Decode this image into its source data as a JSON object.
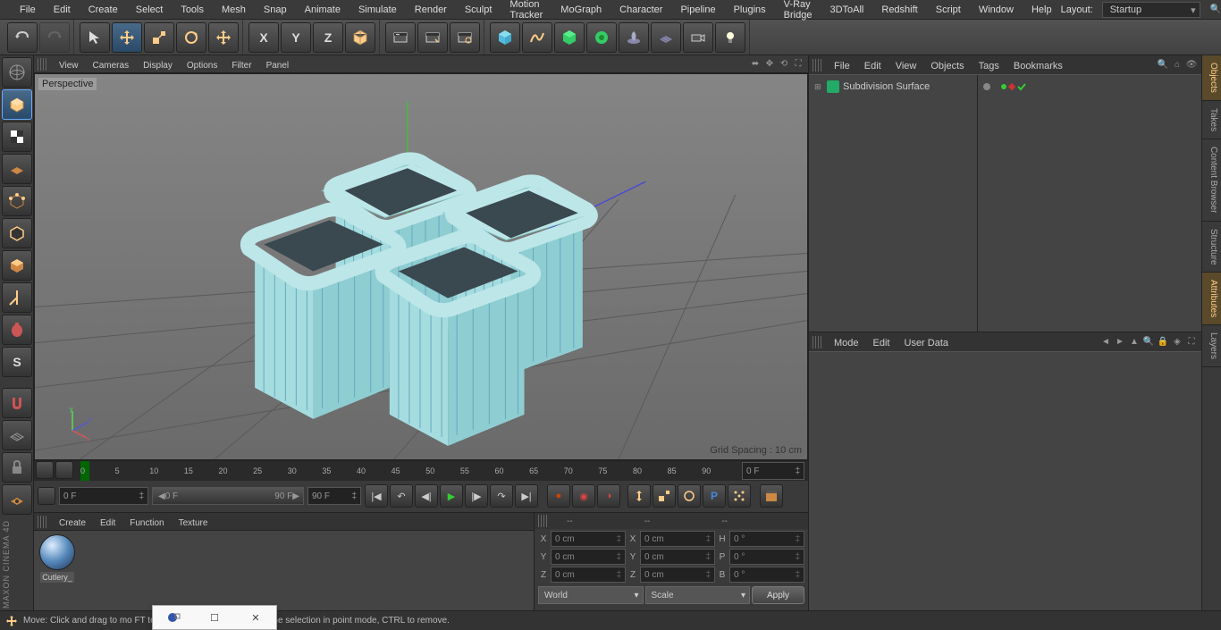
{
  "menubar": [
    "File",
    "Edit",
    "Create",
    "Select",
    "Tools",
    "Mesh",
    "Snap",
    "Animate",
    "Simulate",
    "Render",
    "Sculpt",
    "Motion Tracker",
    "MoGraph",
    "Character",
    "Pipeline",
    "Plugins",
    "V-Ray Bridge",
    "3DToAll",
    "Redshift",
    "Script",
    "Window",
    "Help"
  ],
  "layout": {
    "label": "Layout:",
    "value": "Startup"
  },
  "viewport": {
    "menus": [
      "View",
      "Cameras",
      "Display",
      "Options",
      "Filter",
      "Panel"
    ],
    "label": "Perspective",
    "grid_spacing": "Grid Spacing : 10 cm"
  },
  "timeline": {
    "marks": [
      "0",
      "5",
      "10",
      "15",
      "20",
      "25",
      "30",
      "35",
      "40",
      "45",
      "50",
      "55",
      "60",
      "65",
      "70",
      "75",
      "80",
      "85",
      "90"
    ],
    "end_field": "0 F",
    "f1": "0 F",
    "f2": "0 F",
    "f3": "90 F",
    "f4": "90 F"
  },
  "materials": {
    "menus": [
      "Create",
      "Edit",
      "Function",
      "Texture"
    ],
    "thumb_label": "Cutlery_"
  },
  "coords": {
    "header": [
      "--",
      "--",
      "--"
    ],
    "rows": [
      {
        "a": "X",
        "v1": "0 cm",
        "b": "X",
        "v2": "0 cm",
        "c": "H",
        "v3": "0 °"
      },
      {
        "a": "Y",
        "v1": "0 cm",
        "b": "Y",
        "v2": "0 cm",
        "c": "P",
        "v3": "0 °"
      },
      {
        "a": "Z",
        "v1": "0 cm",
        "b": "Z",
        "v2": "0 cm",
        "c": "B",
        "v3": "0 °"
      }
    ],
    "dd1": "World",
    "dd2": "Scale",
    "apply": "Apply"
  },
  "objects": {
    "menus": [
      "File",
      "Edit",
      "View",
      "Objects",
      "Tags",
      "Bookmarks"
    ],
    "item": "Subdivision Surface"
  },
  "attributes": {
    "menus": [
      "Mode",
      "Edit",
      "User Data"
    ]
  },
  "right_tabs": [
    "Objects",
    "Takes",
    "Content Browser",
    "Structure",
    "Attributes",
    "Layers"
  ],
  "status": "Move: Click and drag to mo                              FT to quantize movement / add to the selection in point mode, CTRL to remove.",
  "axes": [
    "X",
    "Y",
    "Z"
  ]
}
